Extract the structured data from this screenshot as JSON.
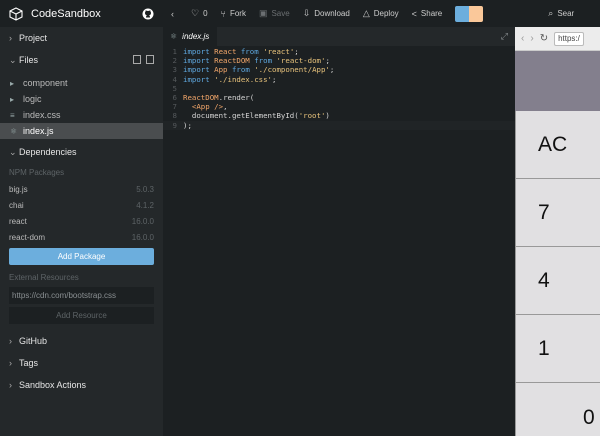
{
  "brand": {
    "title": "CodeSandbox"
  },
  "sidebar": {
    "project_label": "Project",
    "files_label": "Files",
    "files": [
      {
        "name": "component",
        "icon": "folder-icon"
      },
      {
        "name": "logic",
        "icon": "folder-icon"
      },
      {
        "name": "index.css",
        "icon": "css-file-icon"
      },
      {
        "name": "index.js",
        "icon": "js-file-icon"
      }
    ],
    "dependencies_label": "Dependencies",
    "npm_label": "NPM Packages",
    "deps": [
      {
        "name": "big.js",
        "version": "5.0.3"
      },
      {
        "name": "chai",
        "version": "4.1.2"
      },
      {
        "name": "react",
        "version": "16.0.0"
      },
      {
        "name": "react-dom",
        "version": "16.0.0"
      }
    ],
    "add_package": "Add Package",
    "external_label": "External Resources",
    "external_placeholder": "https://cdn.com/bootstrap.css",
    "add_resource": "Add Resource",
    "github_label": "GitHub",
    "tags_label": "Tags",
    "actions_label": "Sandbox Actions"
  },
  "toolbar": {
    "likes": "0",
    "fork": "Fork",
    "save": "Save",
    "download": "Download",
    "deploy": "Deploy",
    "share": "Share",
    "search": "Sear"
  },
  "editor": {
    "tab": "index.js",
    "lines": [
      {
        "n": "1"
      },
      {
        "n": "2"
      },
      {
        "n": "3"
      },
      {
        "n": "4"
      },
      {
        "n": "5"
      },
      {
        "n": "6"
      },
      {
        "n": "7"
      },
      {
        "n": "8"
      },
      {
        "n": "9"
      }
    ]
  },
  "browser": {
    "url": "https:/",
    "keys": [
      "AC",
      "7",
      "4",
      "1",
      "0"
    ]
  }
}
